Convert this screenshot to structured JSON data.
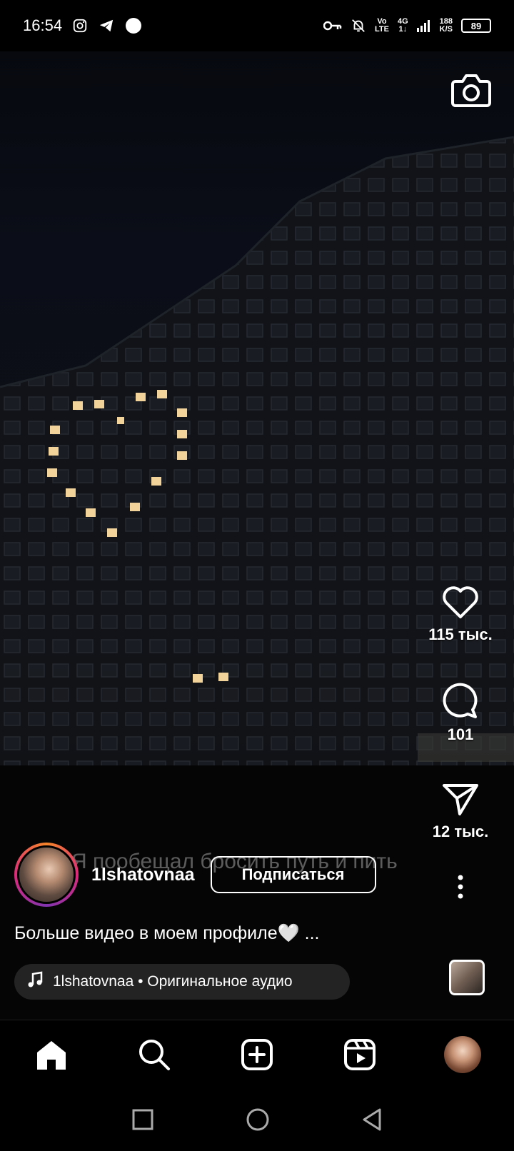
{
  "status_bar": {
    "time": "16:54",
    "net_top": "Vo",
    "net_bottom": "LTE",
    "gen_top": "4G",
    "gen_bottom": "1↓",
    "speed_top": "188",
    "speed_bottom": "K/S",
    "battery": "89"
  },
  "reel": {
    "subtitle_overlay": "Я пообещал бросить путь и пить",
    "likes": "115 тыс.",
    "comments": "101",
    "shares": "12 тыс.",
    "username": "1lshatovnaa",
    "follow_label": "Подписаться",
    "caption": "Больше видео в моем профиле🤍 ...",
    "audio_label": "1lshatovnaa • Оригинальное аудио"
  },
  "icons": {
    "camera": "camera-icon",
    "like": "heart-icon",
    "comment": "comment-icon",
    "share": "send-icon",
    "more": "more-vertical-icon",
    "music": "music-note-icon",
    "home": "home-icon",
    "search": "search-icon",
    "create": "plus-square-icon",
    "reels": "reels-icon",
    "profile": "profile-avatar"
  },
  "colors": {
    "background": "#000000",
    "text": "#ffffff",
    "story_ring_start": "#f58529",
    "story_ring_end": "#8134af"
  }
}
